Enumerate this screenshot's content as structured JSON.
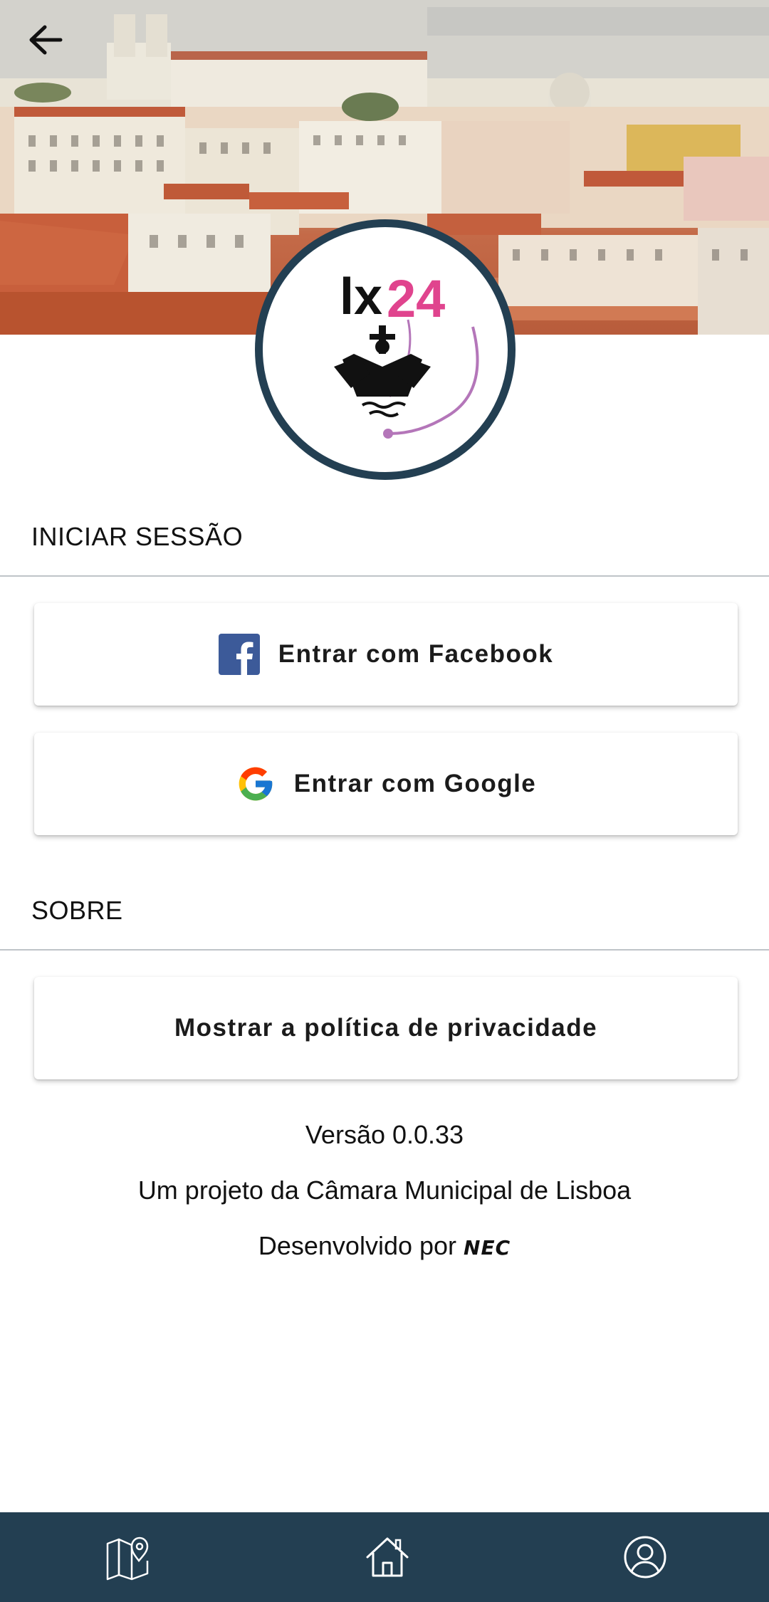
{
  "header": {
    "back_icon": "arrow-left-icon",
    "hero_image": "lisbon-rooftops-photo"
  },
  "logo": {
    "text_lx": "lx",
    "text_num": "24",
    "colors": {
      "ring": "#233f52",
      "accent": "#e0448e",
      "arc": "#b476b9"
    }
  },
  "login": {
    "title": "INICIAR SESSÃO",
    "facebook_label": "Entrar com Facebook",
    "google_label": "Entrar com Google"
  },
  "about": {
    "title": "SOBRE",
    "privacy_label": "Mostrar a política de privacidade",
    "version": "Versão 0.0.33",
    "project": "Um projeto da Câmara Municipal de Lisboa",
    "developed_by": "Desenvolvido por",
    "developer_logo": "NEC"
  },
  "bottom_nav": {
    "items": [
      {
        "icon": "map-pin-icon"
      },
      {
        "icon": "home-icon"
      },
      {
        "icon": "user-profile-icon"
      }
    ],
    "color": "#233f52"
  }
}
